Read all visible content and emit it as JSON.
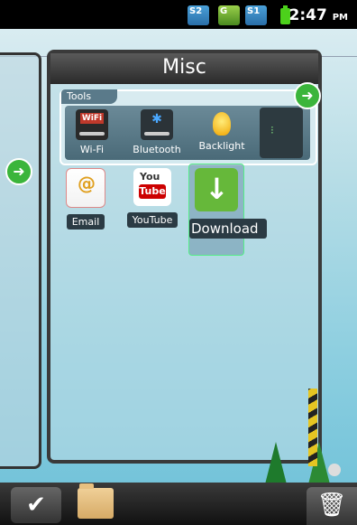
{
  "status_bar": {
    "sim1": "S2",
    "sim2": "G",
    "sim3": "S1",
    "time": "2:47",
    "ampm": "PM"
  },
  "card": {
    "title": "Misc"
  },
  "tools": {
    "label": "Tools",
    "items": [
      {
        "name": "Wi-Fi",
        "icon": "wifi-icon"
      },
      {
        "name": "Bluetooth",
        "icon": "bluetooth-icon"
      },
      {
        "name": "Backlight",
        "icon": "lightbulb-icon"
      }
    ]
  },
  "apps": [
    {
      "name": "Email",
      "icon": "email-icon"
    },
    {
      "name": "YouTube",
      "icon": "youtube-icon"
    },
    {
      "name": "Download",
      "icon": "download-icon"
    }
  ],
  "dock": {
    "check_icon": "check-icon",
    "folder_icon": "folder-icon",
    "trash_icon": "trash-icon"
  }
}
